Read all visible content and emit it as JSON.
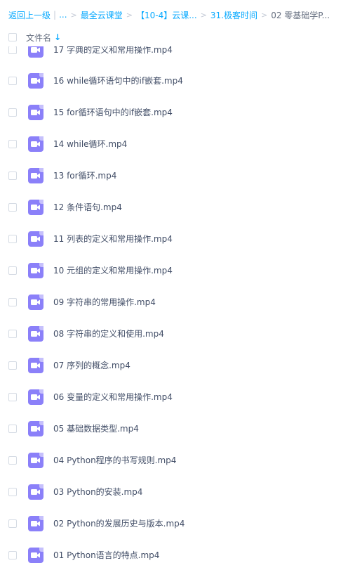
{
  "breadcrumb": {
    "back_label": "返回上一级",
    "ellipsis_label": "...",
    "items": [
      "最全云课堂",
      "【10-4】云课...",
      "31.极客时间"
    ],
    "current": "02 零基础学P..."
  },
  "header": {
    "column_label": "文件名",
    "sort_icon": "arrow-down-icon"
  },
  "files": [
    {
      "name": "17 字典的定义和常用操作.mp4",
      "icon": "video-file-icon"
    },
    {
      "name": "16 while循环语句中的if嵌套.mp4",
      "icon": "video-file-icon"
    },
    {
      "name": "15 for循环语句中的if嵌套.mp4",
      "icon": "video-file-icon"
    },
    {
      "name": "14 while循环.mp4",
      "icon": "video-file-icon"
    },
    {
      "name": "13 for循环.mp4",
      "icon": "video-file-icon"
    },
    {
      "name": "12 条件语句.mp4",
      "icon": "video-file-icon"
    },
    {
      "name": "11 列表的定义和常用操作.mp4",
      "icon": "video-file-icon"
    },
    {
      "name": "10 元组的定义和常用操作.mp4",
      "icon": "video-file-icon"
    },
    {
      "name": "09 字符串的常用操作.mp4",
      "icon": "video-file-icon"
    },
    {
      "name": "08 字符串的定义和使用.mp4",
      "icon": "video-file-icon"
    },
    {
      "name": "07 序列的概念.mp4",
      "icon": "video-file-icon"
    },
    {
      "name": "06 变量的定义和常用操作.mp4",
      "icon": "video-file-icon"
    },
    {
      "name": "05 基础数据类型.mp4",
      "icon": "video-file-icon"
    },
    {
      "name": "04 Python程序的书写规则.mp4",
      "icon": "video-file-icon"
    },
    {
      "name": "03 Python的安装.mp4",
      "icon": "video-file-icon"
    },
    {
      "name": "02 Python的发展历史与版本.mp4",
      "icon": "video-file-icon"
    },
    {
      "name": "01 Python语言的特点.mp4",
      "icon": "video-file-icon"
    }
  ],
  "colors": {
    "accent": "#09aaff",
    "video_icon": "#8b80f9",
    "text": "#424e67"
  }
}
